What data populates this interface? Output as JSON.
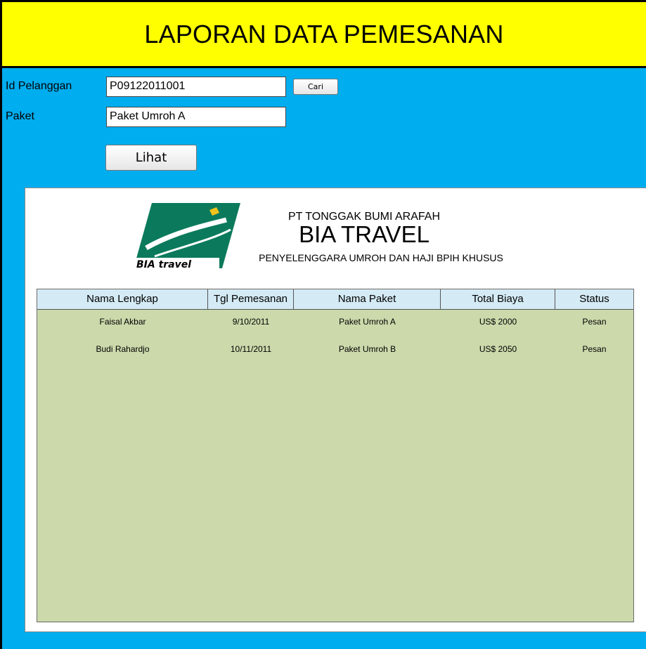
{
  "title": "LAPORAN DATA PEMESANAN",
  "form": {
    "id_label": "Id Pelanggan",
    "id_value": "P09122011001",
    "search_button": "Cari",
    "paket_label": "Paket",
    "paket_value": "Paket Umroh A",
    "view_button": "Lihat"
  },
  "report": {
    "company": "PT TONGGAK BUMI ARAFAH",
    "brand": "BIA TRAVEL",
    "tagline": "PENYELENGGARA UMROH DAN HAJI BPIH KHUSUS",
    "logo_text": "BIA travel",
    "columns": [
      "Nama Lengkap",
      "Tgl Pemesanan",
      "Nama Paket",
      "Total Biaya",
      "Status"
    ],
    "rows": [
      [
        "Faisal Akbar",
        "9/10/2011",
        "Paket Umroh A",
        "US$ 2000",
        "Pesan"
      ],
      [
        "Budi Rahardjo",
        "10/11/2011",
        "Paket Umroh B",
        "US$ 2050",
        "Pesan"
      ]
    ]
  },
  "colors": {
    "title_bg": "#ffff00",
    "window_bg": "#00adef",
    "table_bg": "#cbd9ab",
    "header_bg": "#d4eaf4",
    "logo_green": "#0b7a5c"
  }
}
